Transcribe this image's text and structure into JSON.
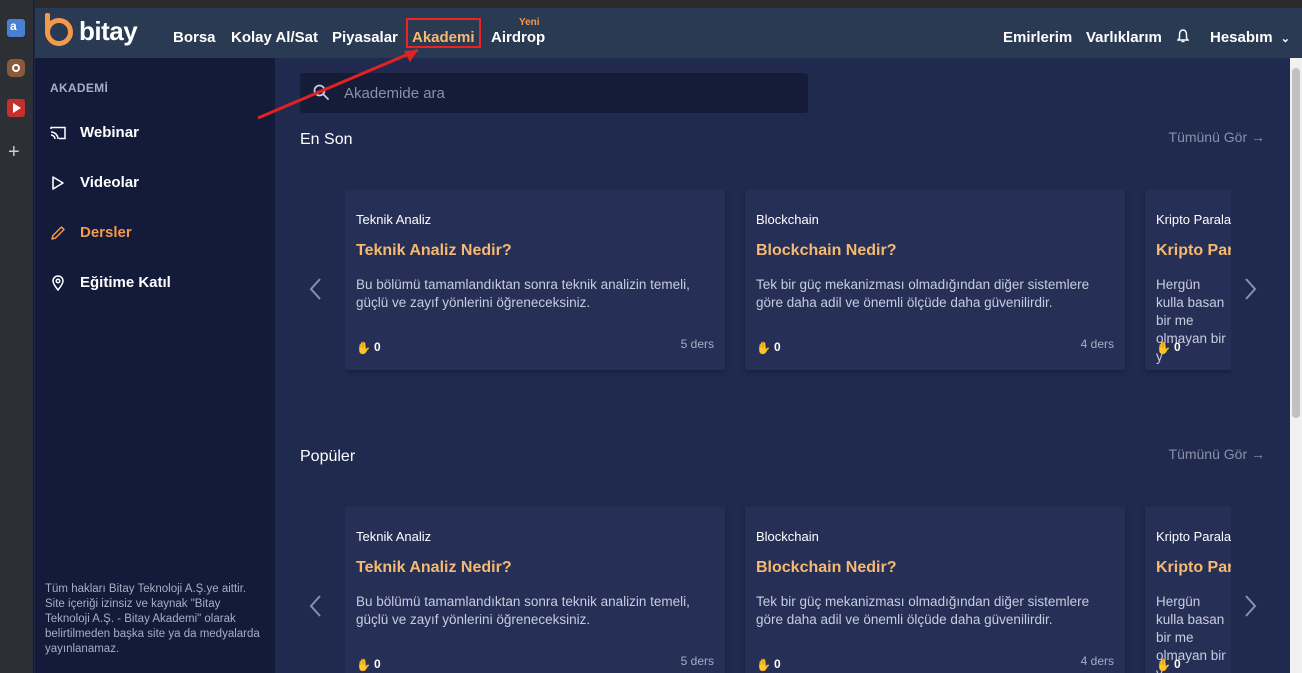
{
  "nav": {
    "logo_text": "bitay",
    "items": [
      "Borsa",
      "Kolay Al/Sat",
      "Piyasalar",
      "Akademi",
      "Airdrop"
    ],
    "new_badge": "Yeni",
    "right": [
      "Emirlerim",
      "Varlıklarım",
      "Hesabım"
    ]
  },
  "sidebar": {
    "title": "AKADEMİ",
    "items": [
      {
        "label": "Webinar",
        "icon": "cast-icon"
      },
      {
        "label": "Videolar",
        "icon": "play-icon"
      },
      {
        "label": "Dersler",
        "icon": "pencil-icon"
      },
      {
        "label": "Eğitime Katıl",
        "icon": "location-pin-icon"
      }
    ],
    "active_item": "Dersler",
    "footer": "Tüm hakları Bitay Teknoloji A.Ş.ye aittir. Site içeriği izinsiz ve kaynak \"Bitay Teknoloji A.Ş. - Bitay Akademi\" olarak belirtilmeden başka site ya da medyalarda yayınlanamaz."
  },
  "search": {
    "placeholder": "Akademide ara"
  },
  "sections": [
    {
      "title": "En Son",
      "see_all": "Tümünü Gör",
      "cards": [
        {
          "category": "Teknik Analiz",
          "title": "Teknik Analiz Nedir?",
          "desc": "Bu bölümü tamamlandıktan sonra teknik analizin temeli, güçlü ve zayıf yönlerini öğreneceksiniz.",
          "likes": "0",
          "lessons": "5 ders"
        },
        {
          "category": "Blockchain",
          "title": "Blockchain Nedir?",
          "desc": "Tek bir güç mekanizması olmadığından diğer sistemlere göre daha adil ve önemli ölçüde daha güvenilirdir.",
          "likes": "0",
          "lessons": "4 ders"
        },
        {
          "category": "Kripto Parala",
          "title": "Kripto Par",
          "desc": "Hergün kulla basan bir me olmayan bir y",
          "likes": "0",
          "lessons": ""
        }
      ]
    },
    {
      "title": "Popüler",
      "see_all": "Tümünü Gör",
      "cards": [
        {
          "category": "Teknik Analiz",
          "title": "Teknik Analiz Nedir?",
          "desc": "Bu bölümü tamamlandıktan sonra teknik analizin temeli, güçlü ve zayıf yönlerini öğreneceksiniz.",
          "likes": "0",
          "lessons": "5 ders"
        },
        {
          "category": "Blockchain",
          "title": "Blockchain Nedir?",
          "desc": "Tek bir güç mekanizması olmadığından diğer sistemlere göre daha adil ve önemli ölçüde daha güvenilirdir.",
          "likes": "0",
          "lessons": "4 ders"
        },
        {
          "category": "Kripto Parala",
          "title": "Kripto Par",
          "desc": "Hergün kulla basan bir me olmayan bir y",
          "likes": "0",
          "lessons": ""
        }
      ]
    }
  ],
  "colors": {
    "accent": "#f2994a",
    "title": "#f5b971",
    "annotation": "#e22222"
  }
}
